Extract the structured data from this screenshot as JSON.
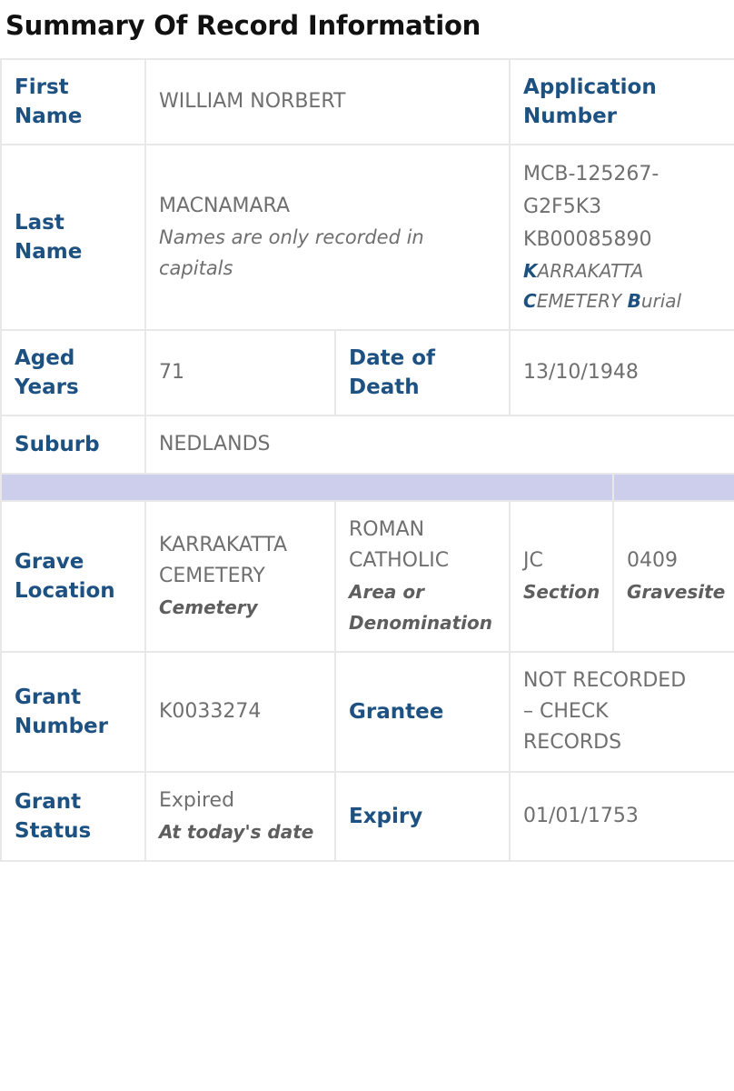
{
  "page": {
    "title": "Summary Of Record Information"
  },
  "colors": {
    "label_blue": "#1d5181",
    "value_gray": "#6f6f6f",
    "spacer_lavender": "#cdcdec",
    "border_gray": "#e8e8e8",
    "title_black": "#111111"
  },
  "record": {
    "first_name": {
      "label": "First Name",
      "value": "WILLIAM NORBERT"
    },
    "application_number": {
      "label": "Application Number",
      "line1": "MCB-125267-",
      "line2": "G2F5K3",
      "line3": "KB00085890",
      "desc_line1_cap": "K",
      "desc_line1_rest": "ARRAKATTA",
      "desc_line2_cap": "C",
      "desc_line2_rest": "EMETERY ",
      "desc_line2_cap2": "B",
      "desc_line2_rest2": "urial"
    },
    "last_name": {
      "label": "Last Name",
      "value": "MACNAMARA",
      "note": "Names are only recorded in capitals"
    },
    "aged_years": {
      "label": "Aged Years",
      "value": "71"
    },
    "date_of_death": {
      "label": "Date of Death",
      "value": "13/10/1948"
    },
    "suburb": {
      "label": "Suburb",
      "value": "NEDLANDS"
    },
    "grave_location": {
      "label": "Grave Location",
      "cemetery_value_line1": "KARRAKATTA",
      "cemetery_value_line2": "CEMETERY",
      "cemetery_caption": "Cemetery",
      "area_value_line1": "ROMAN",
      "area_value_line2": "CATHOLIC",
      "area_caption_line1": "Area or",
      "area_caption_line2": "Denomination",
      "section_value": "JC",
      "section_caption": "Section",
      "gravesite_value": "0409",
      "gravesite_caption": "Gravesite"
    },
    "grant_number": {
      "label": "Grant Number",
      "value": "K0033274"
    },
    "grantee": {
      "label": "Grantee",
      "line1": "NOT RECORDED",
      "line2": "– CHECK",
      "line3": "RECORDS"
    },
    "grant_status": {
      "label": "Grant Status",
      "value": "Expired",
      "note": "At today's date"
    },
    "expiry": {
      "label": "Expiry",
      "value": "01/01/1753"
    }
  }
}
